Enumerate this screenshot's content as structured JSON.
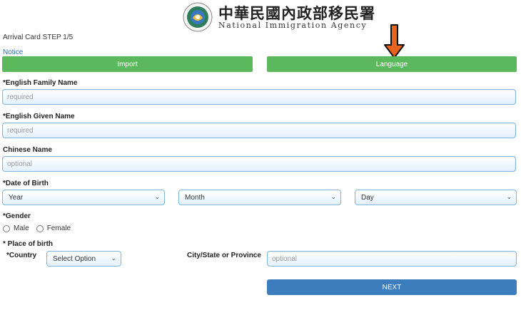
{
  "header": {
    "agency_cn": "中華民國內政部移民署",
    "agency_en": "National Immigration Agency"
  },
  "step_text": "Arrival Card STEP 1/5",
  "notice": "Notice",
  "buttons": {
    "import": "Import",
    "language": "Language",
    "next": "NEXT"
  },
  "fields": {
    "family_name": {
      "label": "*English Family Name",
      "placeholder": "required"
    },
    "given_name": {
      "label": "*English Given Name",
      "placeholder": "required"
    },
    "chinese_name": {
      "label": "Chinese Name",
      "placeholder": "optional"
    },
    "dob": {
      "label": "*Date of Birth",
      "year": "Year",
      "month": "Month",
      "day": "Day"
    },
    "gender": {
      "label": "*Gender",
      "male": "Male",
      "female": "Female"
    },
    "place_of_birth": {
      "label": "* Place of birth",
      "country_label": "*Country",
      "country_value": "Select Option",
      "city_label": "City/State or Province",
      "city_placeholder": "optional"
    }
  },
  "colors": {
    "green_button": "#5cb85c",
    "blue_button": "#3b7dbd",
    "arrow": "#e8641e",
    "notice_link": "#2f6fb0"
  }
}
